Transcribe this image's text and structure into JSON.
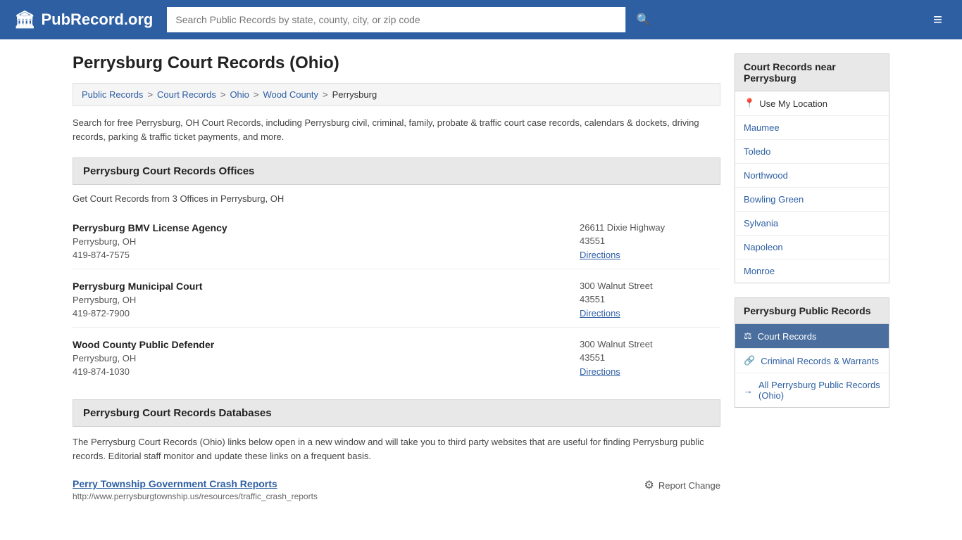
{
  "header": {
    "logo_text": "PubRecord.org",
    "logo_icon": "🏛",
    "search_placeholder": "Search Public Records by state, county, city, or zip code",
    "search_icon": "🔍",
    "menu_icon": "≡"
  },
  "page": {
    "title": "Perrysburg Court Records (Ohio)"
  },
  "breadcrumb": {
    "items": [
      "Public Records",
      "Court Records",
      "Ohio",
      "Wood County",
      "Perrysburg"
    ]
  },
  "intro": {
    "text": "Search for free Perrysburg, OH Court Records, including Perrysburg civil, criminal, family, probate & traffic court case records, calendars & dockets, driving records, parking & traffic ticket payments, and more."
  },
  "offices": {
    "section_title": "Perrysburg Court Records Offices",
    "count_text": "Get Court Records from 3 Offices in Perrysburg, OH",
    "items": [
      {
        "name": "Perrysburg BMV License Agency",
        "city": "Perrysburg, OH",
        "phone": "419-874-7575",
        "address": "26611 Dixie Highway",
        "zip": "43551",
        "directions_label": "Directions"
      },
      {
        "name": "Perrysburg Municipal Court",
        "city": "Perrysburg, OH",
        "phone": "419-872-7900",
        "address": "300 Walnut Street",
        "zip": "43551",
        "directions_label": "Directions"
      },
      {
        "name": "Wood County Public Defender",
        "city": "Perrysburg, OH",
        "phone": "419-874-1030",
        "address": "300 Walnut Street",
        "zip": "43551",
        "directions_label": "Directions"
      }
    ]
  },
  "databases": {
    "section_title": "Perrysburg Court Records Databases",
    "description": "The Perrysburg Court Records (Ohio) links below open in a new window and will take you to third party websites that are useful for finding Perrysburg public records. Editorial staff monitor and update these links on a frequent basis.",
    "items": [
      {
        "title": "Perry Township Government Crash Reports",
        "url": "http://www.perrysburgtownship.us/resources/traffic_crash_reports",
        "report_change_label": "Report Change"
      }
    ]
  },
  "sidebar": {
    "nearby_title": "Court Records near Perrysburg",
    "use_location_label": "Use My Location",
    "use_location_icon": "📍",
    "nearby_cities": [
      "Maumee",
      "Toledo",
      "Northwood",
      "Bowling Green",
      "Sylvania",
      "Napoleon",
      "Monroe"
    ],
    "records_title": "Perrysburg Public Records",
    "records_items": [
      {
        "label": "Court Records",
        "icon": "⚖",
        "active": true
      },
      {
        "label": "Criminal Records & Warrants",
        "icon": "🔗",
        "active": false
      },
      {
        "label": "All Perrysburg Public Records (Ohio)",
        "icon": "→",
        "active": false
      }
    ]
  }
}
